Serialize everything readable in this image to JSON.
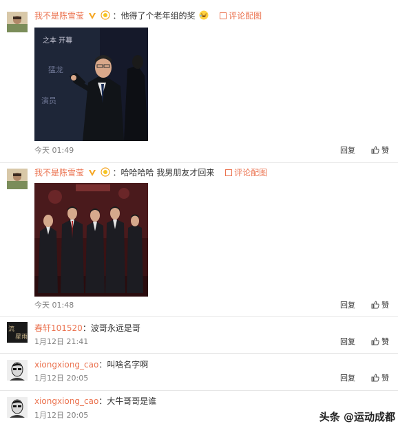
{
  "comments": [
    {
      "username": "我不是陈雪莹",
      "text": "：他得了个老年组的奖",
      "pic_link": "评论配图",
      "time": "今天 01:49",
      "reply": "回复",
      "like": "赞"
    },
    {
      "username": "我不是陈雪莹",
      "text": "：哈哈哈哈 我男朋友才回来",
      "pic_link": "评论配图",
      "time": "今天 01:48",
      "reply": "回复",
      "like": "赞"
    },
    {
      "username": "春轩101520",
      "text": "：波哥永远是哥",
      "time": "1月12日 21:41",
      "reply": "回复",
      "like": "赞"
    },
    {
      "username": "xiongxiong_cao",
      "text": "：叫啥名字啊",
      "time": "1月12日 20:05",
      "reply": "回复",
      "like": "赞"
    },
    {
      "username": "xiongxiong_cao",
      "text": "：大牛哥哥是谁",
      "time": "1月12日 20:05",
      "reply": "回复",
      "like": "赞"
    }
  ],
  "watermark": "头条 @运动成都",
  "colors": {
    "username": "#eb7350",
    "time": "#808080",
    "divider": "#e6e6e6"
  }
}
